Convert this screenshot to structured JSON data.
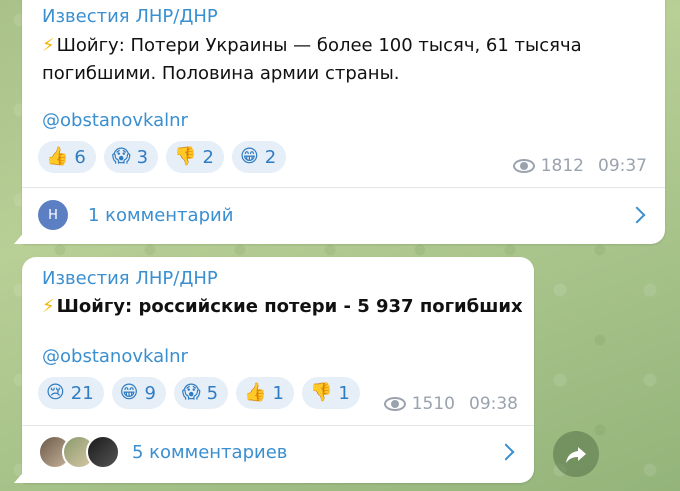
{
  "messages": [
    {
      "channel": "Известия ЛНР/ДНР",
      "text_line1": "Шойгу: Потери Украины — более 100 тысяч, 61 тысяча",
      "text_line2": "погибшими. Половина армии страны.",
      "handle": "@obstanovkalnr",
      "reactions": [
        {
          "emoji": "👍",
          "count": "6"
        },
        {
          "emoji": "😱",
          "count": "3"
        },
        {
          "emoji": "👎",
          "count": "2"
        },
        {
          "emoji": "😁",
          "count": "2"
        }
      ],
      "views": "1812",
      "time": "09:37",
      "comments_label": "1 комментарий",
      "avatar_letter": "Н"
    },
    {
      "channel": "Известия ЛНР/ДНР",
      "text_line1": "Шойгу: российские потери - 5 937 погибших",
      "handle": "@obstanovkalnr",
      "reactions": [
        {
          "emoji": "😢",
          "count": "21"
        },
        {
          "emoji": "😁",
          "count": "9"
        },
        {
          "emoji": "😱",
          "count": "5"
        },
        {
          "emoji": "👍",
          "count": "1"
        },
        {
          "emoji": "👎",
          "count": "1"
        }
      ],
      "views": "1510",
      "time": "09:38",
      "comments_label": "5 комментариев"
    }
  ],
  "colors": {
    "accent": "#3a8fd0",
    "reaction_bg": "#e6eef7",
    "meta": "#9aa3ad",
    "lightning": "#f5b400"
  }
}
